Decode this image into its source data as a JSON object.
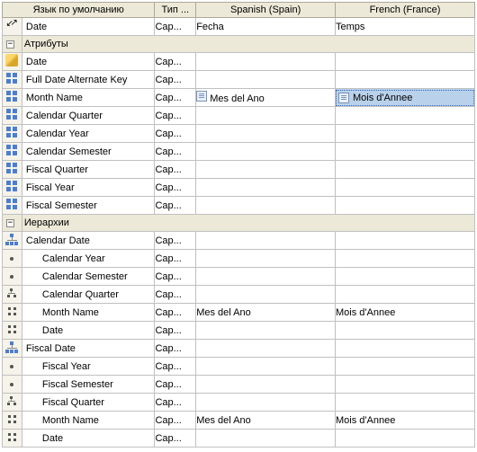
{
  "headers": {
    "default_lang": "Язык по умолчанию",
    "type": "Тип ...",
    "spanish": "Spanish (Spain)",
    "french": "French (France)"
  },
  "top": {
    "name": "Date",
    "type": "Cap...",
    "spanish": "Fecha",
    "french": "Temps"
  },
  "sections": {
    "attributes": "Атрибуты",
    "hierarchies": "Иерархии"
  },
  "attributes": [
    {
      "name": "Date",
      "type": "Cap...",
      "spanish": "",
      "french": ""
    },
    {
      "name": "Full Date Alternate Key",
      "type": "Cap...",
      "spanish": "",
      "french": ""
    },
    {
      "name": "Month Name",
      "type": "Cap...",
      "spanish": "Mes del Ano",
      "french": "Mois d'Annee",
      "selected": true
    },
    {
      "name": "Calendar Quarter",
      "type": "Cap...",
      "spanish": "",
      "french": ""
    },
    {
      "name": "Calendar Year",
      "type": "Cap...",
      "spanish": "",
      "french": ""
    },
    {
      "name": "Calendar Semester",
      "type": "Cap...",
      "spanish": "",
      "french": ""
    },
    {
      "name": "Fiscal Quarter",
      "type": "Cap...",
      "spanish": "",
      "french": ""
    },
    {
      "name": "Fiscal Year",
      "type": "Cap...",
      "spanish": "",
      "french": ""
    },
    {
      "name": "Fiscal Semester",
      "type": "Cap...",
      "spanish": "",
      "french": ""
    }
  ],
  "hierarchies": [
    {
      "name": "Calendar Date",
      "type": "Cap...",
      "levels": [
        {
          "icon": "dot",
          "name": "Calendar Year",
          "type": "Cap...",
          "spanish": "",
          "french": ""
        },
        {
          "icon": "dot",
          "name": "Calendar Semester",
          "type": "Cap...",
          "spanish": "",
          "french": ""
        },
        {
          "icon": "tree",
          "name": "Calendar Quarter",
          "type": "Cap...",
          "spanish": "",
          "french": ""
        },
        {
          "icon": "grid",
          "name": "Month Name",
          "type": "Cap...",
          "spanish": "Mes del Ano",
          "french": "Mois d'Annee"
        },
        {
          "icon": "grid",
          "name": "Date",
          "type": "Cap...",
          "spanish": "",
          "french": ""
        }
      ]
    },
    {
      "name": "Fiscal Date",
      "type": "Cap...",
      "levels": [
        {
          "icon": "dot",
          "name": "Fiscal Year",
          "type": "Cap...",
          "spanish": "",
          "french": ""
        },
        {
          "icon": "dot",
          "name": "Fiscal Semester",
          "type": "Cap...",
          "spanish": "",
          "french": ""
        },
        {
          "icon": "tree",
          "name": "Fiscal Quarter",
          "type": "Cap...",
          "spanish": "",
          "french": ""
        },
        {
          "icon": "grid",
          "name": "Month Name",
          "type": "Cap...",
          "spanish": "Mes del Ano",
          "french": "Mois d'Annee"
        },
        {
          "icon": "grid",
          "name": "Date",
          "type": "Cap...",
          "spanish": "",
          "french": ""
        }
      ]
    }
  ]
}
